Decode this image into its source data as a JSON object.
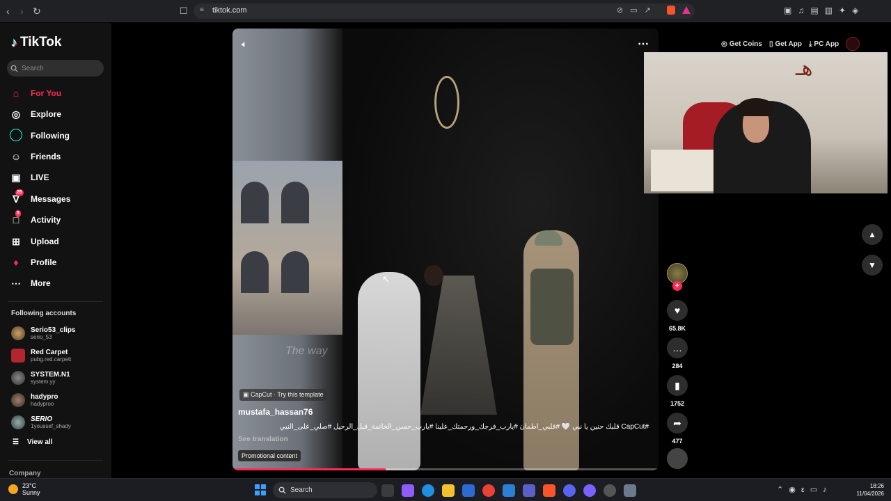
{
  "browser": {
    "url": "tiktok.com"
  },
  "sidebar": {
    "logo": "TikTok",
    "search_placeholder": "Search",
    "nav": [
      {
        "label": "For You",
        "icon": "home-icon"
      },
      {
        "label": "Explore",
        "icon": "compass-icon"
      },
      {
        "label": "Following",
        "icon": "following-icon"
      },
      {
        "label": "Friends",
        "icon": "friends-icon"
      },
      {
        "label": "LIVE",
        "icon": "live-icon"
      },
      {
        "label": "Messages",
        "icon": "messages-icon",
        "badge": "25"
      },
      {
        "label": "Activity",
        "icon": "activity-icon",
        "badge": "5"
      },
      {
        "label": "Upload",
        "icon": "upload-icon"
      },
      {
        "label": "Profile",
        "icon": "profile-icon"
      },
      {
        "label": "More",
        "icon": "more-icon"
      }
    ],
    "following_title": "Following accounts",
    "accounts": [
      {
        "name": "Serio53_clips",
        "handle": "serio_53"
      },
      {
        "name": "Red Carpet",
        "handle": "pubg.red.carpett"
      },
      {
        "name": "SYSTEM.N1",
        "handle": "system.yy"
      },
      {
        "name": "hadypro",
        "handle": "hadyproo"
      },
      {
        "name": "SERIO",
        "handle": "1youssef_shady"
      }
    ],
    "view_all": "View all",
    "company": "Company"
  },
  "video": {
    "template_tag": "CapCut · Try this template",
    "author": "mustafa_hassan76",
    "caption": "#CapCut قلبك حنين يا نبي 🤍 #قلبي_اطمأن #يارب_فرجك_ورحمتك_علينا #يارب_حسن_الخاتمة_قبل_الرحيل #صلي_على_النبي",
    "see_translation": "See translation",
    "promotional": "Promotional content",
    "watermark": "The way",
    "progress": 0.36
  },
  "actions": {
    "likes": "65.8K",
    "comments": "284",
    "saves": "1752",
    "shares": "477"
  },
  "topbar": {
    "get_coins": "Get Coins",
    "get_app": "Get App",
    "pc_app": "PC App"
  },
  "taskbar": {
    "temp": "23°C",
    "weather": "Sunny",
    "search": "Search",
    "time": "18:26",
    "date": "11/04/2026"
  },
  "colors": {
    "accent": "#fe2c55",
    "cyan": "#25f4ee"
  }
}
